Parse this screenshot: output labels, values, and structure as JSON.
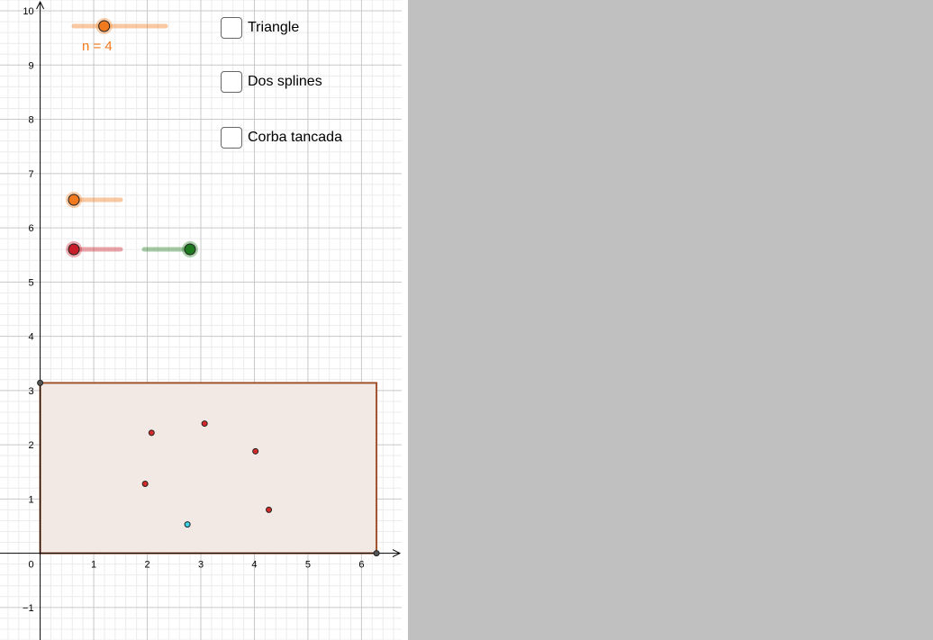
{
  "graphics": {
    "x_ticks": [
      "1",
      "2",
      "3",
      "4",
      "5",
      "6"
    ],
    "y_ticks": [
      "−1",
      "1",
      "2",
      "3",
      "4",
      "5",
      "6",
      "7",
      "8",
      "9",
      "10"
    ],
    "origin_label": "0",
    "x_range": [
      -0.75,
      6.75
    ],
    "y_range": [
      -1.6,
      10.2
    ],
    "rectangle": {
      "x_min": 0,
      "x_max": 6.28,
      "y_min": 0,
      "y_max": 3.14
    },
    "corner_points": [
      {
        "x": 0,
        "y": 3.14
      },
      {
        "x": 6.28,
        "y": 0
      }
    ],
    "red_points": [
      {
        "x": 2.08,
        "y": 2.22
      },
      {
        "x": 3.07,
        "y": 2.39
      },
      {
        "x": 4.02,
        "y": 1.88
      },
      {
        "x": 1.96,
        "y": 1.28
      },
      {
        "x": 4.27,
        "y": 0.8
      }
    ],
    "cyan_point": {
      "x": 2.75,
      "y": 0.53
    },
    "colors": {
      "rectangle_stroke": "#a0522d",
      "rectangle_fill": "#f3e9e4",
      "point_red": "#d42a2a",
      "point_cyan": "#3cd4e6",
      "slider_orange": "#f27a1e",
      "slider_red": "#c81e2a",
      "slider_green": "#1e7a1e",
      "axis": "#000000",
      "grid_major": "#c8c8c8",
      "grid_minor": "#ececec"
    }
  },
  "sliders": {
    "n": {
      "label": "n = 4",
      "value": 4,
      "fraction": 0.33
    },
    "orange": {
      "fraction": 0.0
    },
    "red": {
      "fraction": 0.0
    },
    "green": {
      "fraction": 1.0
    }
  },
  "checkboxes": [
    {
      "label": "Triangle",
      "checked": false
    },
    {
      "label": "Dos splines",
      "checked": false
    },
    {
      "label": "Corba tancada",
      "checked": false
    }
  ]
}
